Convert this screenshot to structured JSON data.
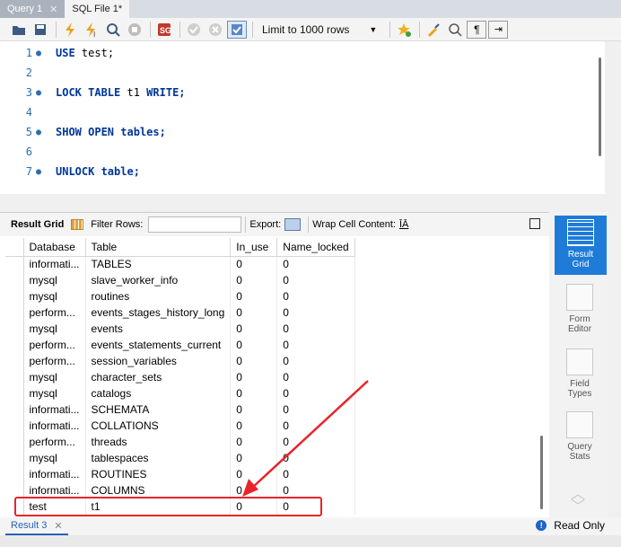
{
  "tabs": [
    {
      "label": "Query 1",
      "active": false
    },
    {
      "label": "SQL File 1*",
      "active": true
    }
  ],
  "toolbar": {
    "icons": [
      "folder-icon",
      "save-icon",
      "execute-icon",
      "execute-current-icon",
      "explain-icon",
      "stop-icon",
      "toggle-stop-on-error-icon",
      "commit-icon",
      "rollback-icon",
      "autocommit-icon"
    ],
    "limit_label": "Limit to 1000 rows",
    "right_icons": [
      "bookmark-icon",
      "beautify-icon",
      "find-icon",
      "invisible-chars-icon",
      "wrap-icon"
    ]
  },
  "editor": {
    "lines": [
      {
        "num": "1",
        "marker": true,
        "keyword": "USE",
        "rest": "test;"
      },
      {
        "num": "2",
        "marker": false,
        "keyword": "",
        "rest": ""
      },
      {
        "num": "3",
        "marker": true,
        "keyword": "LOCK TABLE",
        "rest": "t1",
        "keyword2": "WRITE;"
      },
      {
        "num": "4",
        "marker": false,
        "keyword": "",
        "rest": ""
      },
      {
        "num": "5",
        "marker": true,
        "keyword": "SHOW OPEN tables;",
        "rest": ""
      },
      {
        "num": "6",
        "marker": false,
        "keyword": "",
        "rest": ""
      },
      {
        "num": "7",
        "marker": true,
        "keyword": "UNLOCK table;",
        "rest": ""
      }
    ]
  },
  "result_toolbar": {
    "result_grid": "Result Grid",
    "filter_rows": "Filter Rows:",
    "export": "Export:",
    "wrap_cell": "Wrap Cell Content:",
    "wrap_icon": "ĪĀ"
  },
  "grid": {
    "columns": [
      "Database",
      "Table",
      "In_use",
      "Name_locked"
    ],
    "rows": [
      [
        "informati...",
        "TABLES",
        "0",
        "0"
      ],
      [
        "mysql",
        "slave_worker_info",
        "0",
        "0"
      ],
      [
        "mysql",
        "routines",
        "0",
        "0"
      ],
      [
        "perform...",
        "events_stages_history_long",
        "0",
        "0"
      ],
      [
        "mysql",
        "events",
        "0",
        "0"
      ],
      [
        "perform...",
        "events_statements_current",
        "0",
        "0"
      ],
      [
        "perform...",
        "session_variables",
        "0",
        "0"
      ],
      [
        "mysql",
        "character_sets",
        "0",
        "0"
      ],
      [
        "mysql",
        "catalogs",
        "0",
        "0"
      ],
      [
        "informati...",
        "SCHEMATA",
        "0",
        "0"
      ],
      [
        "informati...",
        "COLLATIONS",
        "0",
        "0"
      ],
      [
        "perform...",
        "threads",
        "0",
        "0"
      ],
      [
        "mysql",
        "tablespaces",
        "0",
        "0"
      ],
      [
        "informati...",
        "ROUTINES",
        "0",
        "0"
      ],
      [
        "informati...",
        "COLUMNS",
        "0",
        "0"
      ],
      [
        "test",
        "t1",
        "0",
        "0"
      ]
    ]
  },
  "sidebar": {
    "items": [
      {
        "label": "Result\nGrid",
        "l1": "Result",
        "l2": "Grid",
        "active": true
      },
      {
        "l1": "Form",
        "l2": "Editor",
        "active": false
      },
      {
        "l1": "Field",
        "l2": "Types",
        "active": false
      },
      {
        "l1": "Query",
        "l2": "Stats",
        "active": false
      }
    ]
  },
  "status": {
    "result_tab": "Result 3",
    "read_only": "Read Only",
    "info_glyph": "!"
  },
  "colors": {
    "accent": "#1e7bd8",
    "highlight": "#e8232a",
    "keyword": "#00369a"
  }
}
